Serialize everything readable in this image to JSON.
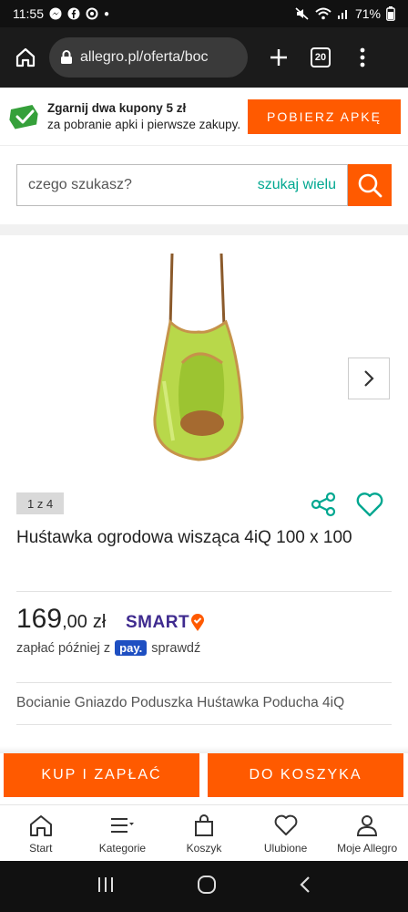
{
  "status_bar": {
    "time": "11:55",
    "battery": "71%"
  },
  "browser": {
    "url": "allegro.pl/oferta/boc",
    "tab_count": "20"
  },
  "promo": {
    "title": "Zgarnij dwa kupony 5 zł",
    "subtitle": "za pobranie apki i pierwsze zakupy.",
    "button": "POBIERZ APKĘ"
  },
  "search": {
    "placeholder": "czego szukasz?",
    "many": "szukaj wielu"
  },
  "gallery": {
    "pager": "1 z 4"
  },
  "product": {
    "title": "Huśtawka ogrodowa wisząca 4iQ 100 x 100",
    "price_main": "169",
    "price_cents": ",00",
    "currency": "zł",
    "smart_label": "SMART",
    "pay_later_prefix": "zapłać później z",
    "pay_logo": "pay.",
    "pay_later_link": "sprawdź",
    "description": "Bocianie Gniazdo Poduszka Huśtawka Poducha 4iQ"
  },
  "actions": {
    "buy": "KUP I ZAPŁAĆ",
    "cart": "DO KOSZYKA"
  },
  "bottom_nav": [
    {
      "label": "Start",
      "icon": "home-icon"
    },
    {
      "label": "Kategorie",
      "icon": "menu-icon"
    },
    {
      "label": "Koszyk",
      "icon": "bag-icon"
    },
    {
      "label": "Ulubione",
      "icon": "heart-icon"
    },
    {
      "label": "Moje Allegro",
      "icon": "user-icon"
    }
  ],
  "colors": {
    "accent": "#ff5a00",
    "teal": "#00a790",
    "smart": "#3f2b8f"
  }
}
